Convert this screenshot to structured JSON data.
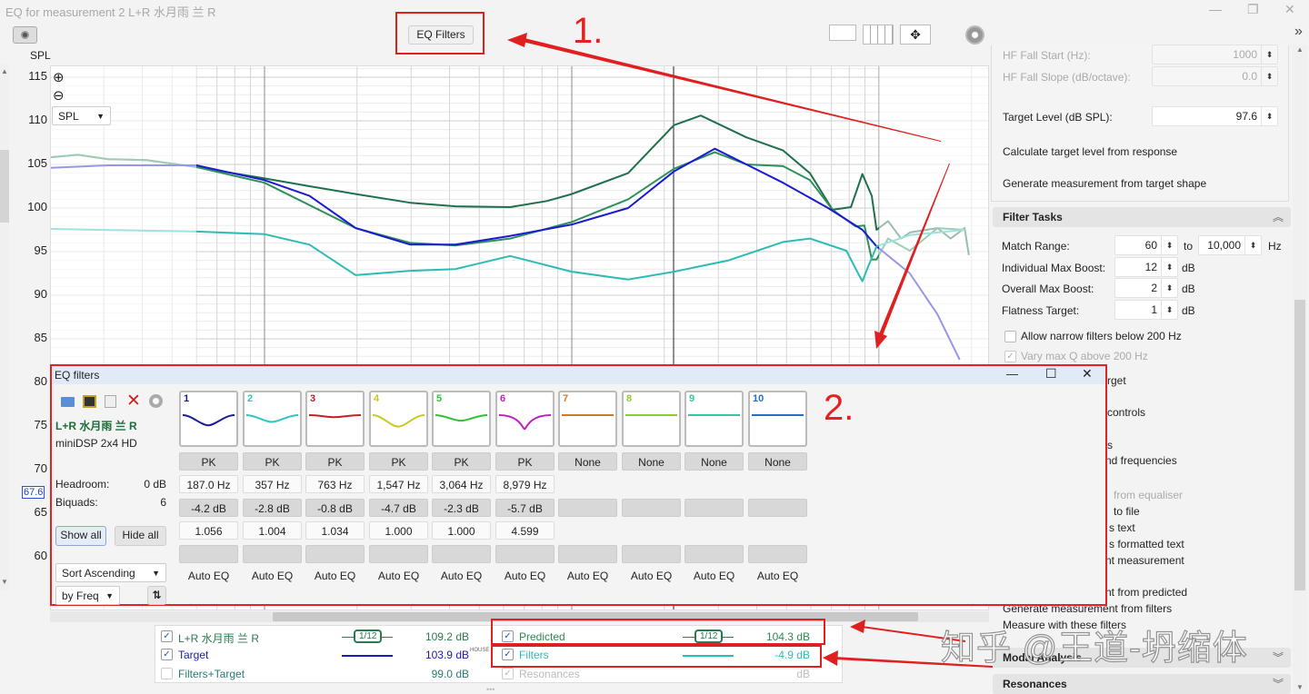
{
  "window": {
    "title": "EQ for measurement 2 L+R 水月雨 兰 R",
    "controls": [
      "—",
      "❐",
      "✕"
    ]
  },
  "toolbar": {
    "eq_filters_label": "EQ Filters",
    "expand_label": "»",
    "annotation_1": "1.",
    "annotation_2": "2."
  },
  "chart": {
    "y_unit_label": "SPL",
    "mode_select": "SPL",
    "cursor_value": "67.6",
    "y_ticks": [
      "115",
      "110",
      "105",
      "100",
      "95",
      "90",
      "85",
      "80",
      "75",
      "70",
      "65",
      "60"
    ]
  },
  "chart_data": {
    "type": "line",
    "xscale": "log",
    "xlim": [
      20,
      23000
    ],
    "ylim": [
      55.5,
      116.25
    ],
    "ylabel": "SPL",
    "grid": true,
    "y_ticks": [
      115,
      110,
      105,
      100,
      95,
      90,
      85,
      80,
      75,
      70,
      65,
      60
    ],
    "match_range_hz": [
      60,
      10000
    ],
    "series": [
      {
        "name": "L+R 水月雨 兰 R",
        "color": "#1f6f4c",
        "points": [
          [
            20,
            105.8
          ],
          [
            24.7,
            106.1
          ],
          [
            31,
            105.6
          ],
          [
            41.3,
            105.5
          ],
          [
            60,
            104.7
          ],
          [
            100,
            103.4
          ],
          [
            140,
            102.5
          ],
          [
            198,
            101.6
          ],
          [
            298,
            100.6
          ],
          [
            418,
            100.2
          ],
          [
            630,
            100.1
          ],
          [
            830,
            100.8
          ],
          [
            1000,
            101.6
          ],
          [
            1526,
            104.0
          ],
          [
            2150,
            109.5
          ],
          [
            2630,
            110.6
          ],
          [
            3700,
            108.1
          ],
          [
            4870,
            106.6
          ],
          [
            5960,
            104.0
          ],
          [
            7060,
            99.8
          ],
          [
            8100,
            100.1
          ],
          [
            8830,
            103.9
          ],
          [
            9470,
            101.4
          ],
          [
            9820,
            97.5
          ],
          [
            10700,
            98.5
          ],
          [
            11800,
            96.5
          ],
          [
            12600,
            97.2
          ],
          [
            15500,
            97.7
          ],
          [
            17100,
            96.5
          ],
          [
            19000,
            97.7
          ],
          [
            19600,
            94.6
          ]
        ]
      },
      {
        "name": "Predicted",
        "color": "#2e8f5a",
        "points": [
          [
            20,
            105.8
          ],
          [
            24.7,
            106.1
          ],
          [
            31,
            105.6
          ],
          [
            41.3,
            105.5
          ],
          [
            60,
            104.7
          ],
          [
            100,
            102.9
          ],
          [
            198,
            97.7
          ],
          [
            298,
            96.0
          ],
          [
            418,
            95.7
          ],
          [
            630,
            96.5
          ],
          [
            1000,
            98.4
          ],
          [
            1526,
            101.0
          ],
          [
            2150,
            104.5
          ],
          [
            2920,
            106.4
          ],
          [
            3700,
            105.0
          ],
          [
            4870,
            104.8
          ],
          [
            5960,
            103.2
          ],
          [
            7060,
            99.8
          ],
          [
            8380,
            97.9
          ],
          [
            8960,
            98.0
          ],
          [
            9470,
            94.1
          ],
          [
            9820,
            94.1
          ],
          [
            10700,
            96.5
          ],
          [
            12600,
            95.1
          ],
          [
            15500,
            97.7
          ],
          [
            19000,
            97.5
          ]
        ]
      },
      {
        "name": "Target",
        "color": "#1a1ad0",
        "points": [
          [
            20,
            104.6
          ],
          [
            31,
            104.9
          ],
          [
            60,
            104.9
          ],
          [
            100,
            103.2
          ],
          [
            140,
            101.4
          ],
          [
            198,
            97.7
          ],
          [
            298,
            95.8
          ],
          [
            418,
            95.8
          ],
          [
            630,
            96.8
          ],
          [
            1000,
            98.1
          ],
          [
            1526,
            100.0
          ],
          [
            2150,
            104.2
          ],
          [
            2920,
            106.8
          ],
          [
            3700,
            105.0
          ],
          [
            4870,
            102.9
          ],
          [
            6830,
            100.0
          ],
          [
            8830,
            97.5
          ],
          [
            9820,
            95.6
          ],
          [
            12600,
            92.5
          ],
          [
            15500,
            87.8
          ],
          [
            18300,
            82.6
          ]
        ]
      },
      {
        "name": "Filters",
        "color": "#2bbcb4",
        "points": [
          [
            20,
            97.6
          ],
          [
            60,
            97.3
          ],
          [
            100,
            97.0
          ],
          [
            140,
            95.8
          ],
          [
            198,
            92.3
          ],
          [
            298,
            92.8
          ],
          [
            418,
            93.0
          ],
          [
            630,
            94.5
          ],
          [
            1000,
            92.7
          ],
          [
            1526,
            91.8
          ],
          [
            2150,
            92.7
          ],
          [
            3240,
            94.0
          ],
          [
            4870,
            96.1
          ],
          [
            5960,
            96.5
          ],
          [
            7830,
            95.1
          ],
          [
            8550,
            92.5
          ],
          [
            8830,
            91.6
          ],
          [
            9270,
            93.5
          ],
          [
            9820,
            95.6
          ],
          [
            12600,
            96.9
          ],
          [
            19000,
            97.5
          ]
        ]
      }
    ]
  },
  "right_panel": {
    "hf_fall_start_label": "HF Fall Start (Hz):",
    "hf_fall_start_value": "1000",
    "hf_fall_slope_label": "HF Fall Slope (dB/octave):",
    "hf_fall_slope_value": "0.0",
    "target_level_label": "Target Level (dB SPL):",
    "target_level_value": "97.6",
    "calc_target_level": "Calculate target level from response",
    "generate_from_target": "Generate measurement from target shape",
    "filter_tasks_title": "Filter Tasks",
    "match_range_label": "Match Range:",
    "match_from": "60",
    "to_label": "to",
    "match_to": "10,000",
    "hz_unit": "Hz",
    "ind_max_boost_label": "Individual Max Boost:",
    "ind_max_boost": "12",
    "overall_max_boost_label": "Overall Max Boost:",
    "overall_max_boost": "2",
    "flatness_label": "Flatness Target:",
    "flatness": "1",
    "db_unit": "dB",
    "allow_narrow_label": "Allow narrow filters below 200 Hz",
    "allow_narrow_checked": false,
    "vary_q_label": "Vary max Q above 200 Hz",
    "vary_q_checked": true,
    "fragments": [
      "rget",
      "controls",
      "s",
      "nd frequencies",
      "from equaliser",
      "to file",
      "s text",
      "s formatted text",
      "nt measurement",
      "nt from predicted"
    ],
    "gen_from_filters": "Generate measurement from filters",
    "measure_with_filters": "Measure with these filters",
    "modal_analysis_title": "Modal Analysis",
    "resonances_title": "Resonances"
  },
  "eq_dialog": {
    "title": "EQ filters",
    "measurement_name": "L+R 水月雨 兰 R",
    "equaliser": "miniDSP 2x4 HD",
    "headroom_label": "Headroom:",
    "headroom_value": "0 dB",
    "biquads_label": "Biquads:",
    "biquads_value": "6",
    "show_all": "Show all",
    "hide_all": "Hide all",
    "sort_order": "Sort Ascending",
    "sort_by": "by Freq",
    "filters": [
      {
        "num": "1",
        "color": "#1a1a9a",
        "type": "PK",
        "freq": "187.0 Hz",
        "gain": "-4.2 dB",
        "q": "1.056",
        "mode": "Auto EQ",
        "depth": 0.4,
        "width": 1
      },
      {
        "num": "2",
        "color": "#2cc8c0",
        "type": "PK",
        "freq": "357 Hz",
        "gain": "-2.8 dB",
        "q": "1.004",
        "mode": "Auto EQ",
        "depth": 0.27,
        "width": 1
      },
      {
        "num": "3",
        "color": "#c02020",
        "type": "PK",
        "freq": "763 Hz",
        "gain": "-0.8 dB",
        "q": "1.034",
        "mode": "Auto EQ",
        "depth": 0.08,
        "width": 1
      },
      {
        "num": "4",
        "color": "#c8c820",
        "type": "PK",
        "freq": "1,547 Hz",
        "gain": "-4.7 dB",
        "q": "1.000",
        "mode": "Auto EQ",
        "depth": 0.45,
        "width": 1
      },
      {
        "num": "5",
        "color": "#30c030",
        "type": "PK",
        "freq": "3,064 Hz",
        "gain": "-2.3 dB",
        "q": "1.000",
        "mode": "Auto EQ",
        "depth": 0.22,
        "width": 1
      },
      {
        "num": "6",
        "color": "#c020c0",
        "type": "PK",
        "freq": "8,979 Hz",
        "gain": "-5.7 dB",
        "q": "4.599",
        "mode": "Auto EQ",
        "depth": 0.55,
        "width": 0.25
      },
      {
        "num": "7",
        "color": "#d07a20",
        "type": "None",
        "freq": "",
        "gain": "",
        "q": "",
        "mode": "Auto EQ",
        "depth": 0,
        "width": 1
      },
      {
        "num": "8",
        "color": "#8ccc30",
        "type": "None",
        "freq": "",
        "gain": "",
        "q": "",
        "mode": "Auto EQ",
        "depth": 0,
        "width": 1
      },
      {
        "num": "9",
        "color": "#30c8a0",
        "type": "None",
        "freq": "",
        "gain": "",
        "q": "",
        "mode": "Auto EQ",
        "depth": 0,
        "width": 1
      },
      {
        "num": "10",
        "color": "#2070c8",
        "type": "None",
        "freq": "",
        "gain": "",
        "q": "",
        "mode": "Auto EQ",
        "depth": 0,
        "width": 1
      }
    ]
  },
  "legend": {
    "rows": [
      {
        "label": "L+R 水月雨 兰 R",
        "checked": true,
        "color": "#2a7a50",
        "smoothing": "1/12",
        "value": "109.2 dB"
      },
      {
        "label": "Target",
        "checked": true,
        "color": "#1a1ab0",
        "value": "103.9 dB",
        "suffix": "HOUSE"
      },
      {
        "label": "Filters+Target",
        "checked": false,
        "color": "#2a7a70",
        "value": "99.0 dB"
      },
      {
        "label": "Predicted",
        "checked": true,
        "color": "#2e8a50",
        "smoothing": "1/12",
        "value": "104.3 dB"
      },
      {
        "label": "Filters",
        "checked": true,
        "color": "#2bbcb4",
        "value": "-4.9 dB"
      },
      {
        "label": "Resonances",
        "checked": true,
        "color": "#bbbbbb",
        "value": "dB"
      }
    ]
  },
  "watermark": "知乎 @王道-坍缩体",
  "colors": {
    "annotation_red": "#e02020",
    "dialog_title_bg": "#e1ebf7"
  }
}
